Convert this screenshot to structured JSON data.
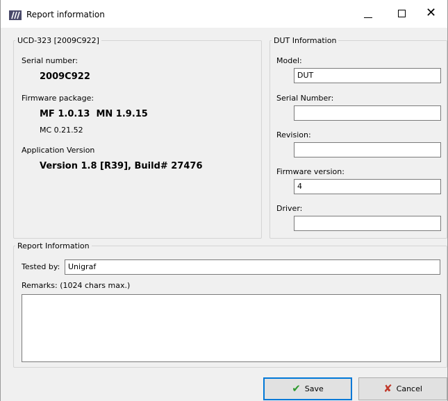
{
  "window": {
    "title": "Report information",
    "app_icon": "unigraf-stripes-icon",
    "controls": {
      "minimize": "minimize-icon",
      "maximize": "maximize-icon",
      "close": "close-icon",
      "close_glyph": "✕"
    }
  },
  "device_group": {
    "legend": "UCD-323 [2009C922]",
    "serial_label": "Serial number:",
    "serial_value": "2009C922",
    "firmware_label": "Firmware package:",
    "firmware_value": "MF 1.0.13  MN 1.9.15",
    "mc_value": "MC 0.21.52",
    "app_label": "Application Version",
    "app_value": "Version 1.8 [R39], Build# 27476"
  },
  "dut_group": {
    "legend": "DUT Information",
    "model_label": "Model:",
    "model_value": "DUT",
    "serial_label": "Serial Number:",
    "serial_value": "",
    "revision_label": "Revision:",
    "revision_value": "",
    "firmware_label": "Firmware version:",
    "firmware_value": "4",
    "driver_label": "Driver:",
    "driver_value": ""
  },
  "report_group": {
    "legend": "Report Information",
    "tested_by_label": "Tested by:",
    "tested_by_value": "Unigraf",
    "remarks_label": "Remarks: (1024 chars max.)",
    "remarks_value": ""
  },
  "buttons": {
    "save_label": "Save",
    "save_icon": "checkmark-icon",
    "cancel_label": "Cancel",
    "cancel_icon": "red-x-icon"
  },
  "colors": {
    "save_focus_border": "#0078d7",
    "check_green": "#2e9a2e",
    "cancel_red": "#c0392b"
  }
}
